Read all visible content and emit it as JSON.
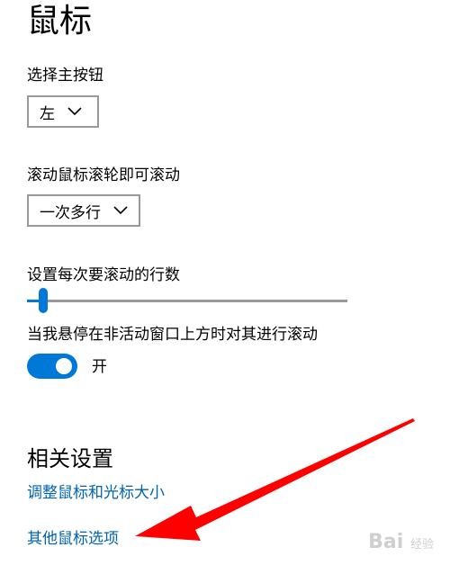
{
  "page": {
    "title": "鼠标"
  },
  "primary_button": {
    "label": "选择主按钮",
    "value": "左"
  },
  "scroll": {
    "label": "滚动鼠标滚轮即可滚动",
    "value": "一次多行"
  },
  "lines": {
    "label": "设置每次要滚动的行数",
    "value_fraction": 0.03
  },
  "inactive_scroll": {
    "label": "当我悬停在非活动窗口上方时对其进行滚动",
    "state": "开"
  },
  "related": {
    "title": "相关设置",
    "link1": "调整鼠标和光标大小",
    "link2": "其他鼠标选项"
  },
  "watermark": {
    "brand": "Bai",
    "suffix": "经验"
  },
  "colors": {
    "accent": "#0078d7",
    "link": "#0063b1",
    "arrow": "#ff0000"
  }
}
